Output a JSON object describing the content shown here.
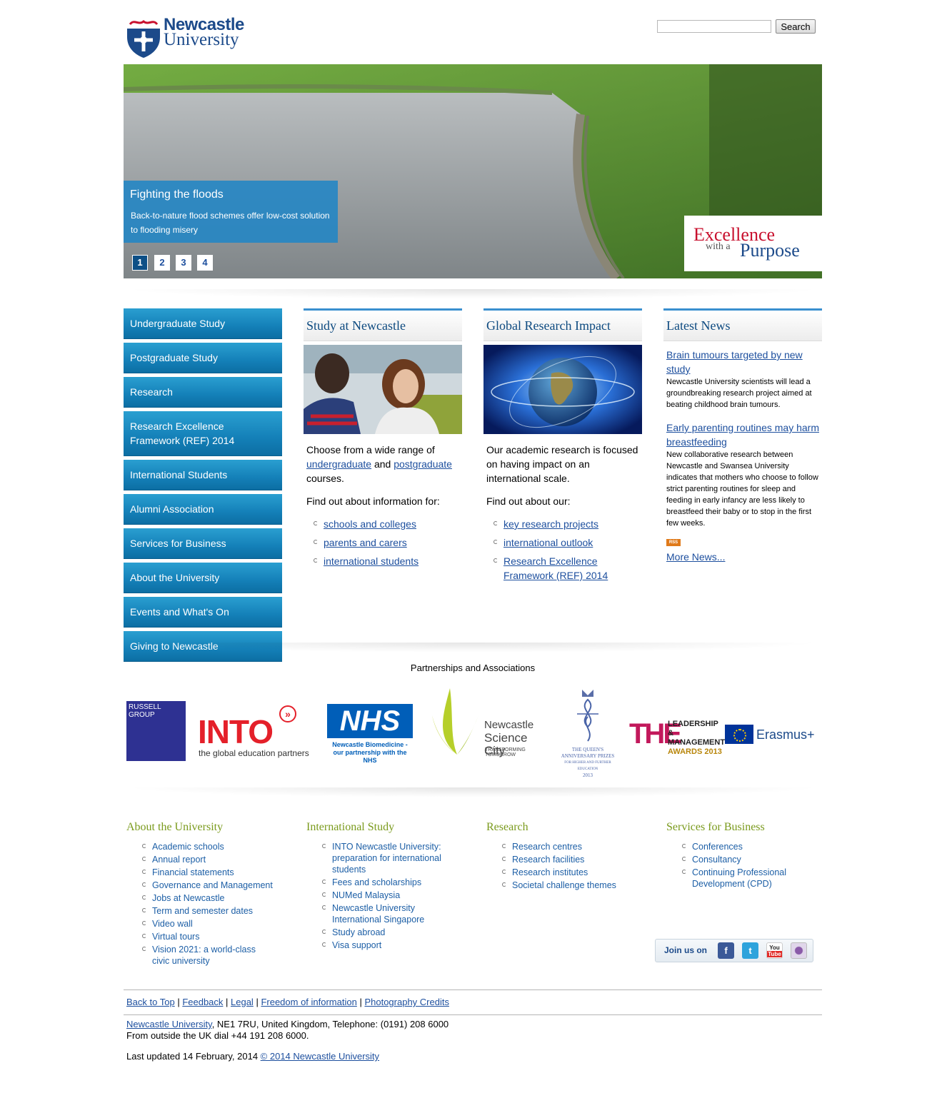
{
  "header": {
    "logo_line1": "Newcastle",
    "logo_line2": "University",
    "search_placeholder": "",
    "search_button": "Search"
  },
  "hero": {
    "title": "Fighting the floods",
    "description": "Back-to-nature flood schemes offer low-cost solution to flooding misery",
    "slides": [
      "1",
      "2",
      "3",
      "4"
    ],
    "active_slide": "1",
    "badge_line1": "Excellence",
    "badge_with": "with a",
    "badge_line2": "Purpose"
  },
  "leftnav": [
    "Undergraduate Study",
    "Postgraduate Study",
    "Research",
    "Research Excellence Framework (REF) 2014",
    "International Students",
    "Alumni Association",
    "Services for Business",
    "About the University",
    "Events and What's On",
    "Giving to Newcastle"
  ],
  "study": {
    "heading": "Study at Newcastle",
    "intro_pre": "Choose from a wide range of ",
    "intro_link1": "undergraduate",
    "intro_mid": " and ",
    "intro_link2": "postgraduate",
    "intro_post": " courses.",
    "find_out": "Find out about information for:",
    "links": [
      "schools and colleges",
      "parents and carers",
      "international students"
    ]
  },
  "research": {
    "heading": "Global Research Impact",
    "intro": "Our academic research is focused on having impact on an international scale.",
    "find_out": "Find out about our:",
    "links": [
      "key research projects",
      "international outlook",
      "Research Excellence Framework (REF) 2014"
    ]
  },
  "news": {
    "heading": "Latest News",
    "items": [
      {
        "title": "Brain tumours targeted by new study",
        "desc": "Newcastle University scientists will lead a groundbreaking research project aimed at beating childhood brain tumours."
      },
      {
        "title": "Early parenting routines may harm breastfeeding",
        "desc": "New collaborative research between Newcastle and Swansea University indicates that mothers who choose to follow strict parenting routines for sleep and feeding in early infancy are less likely to breastfeed their baby or to stop in the first few weeks."
      }
    ],
    "rss": "RSS",
    "more": "More News..."
  },
  "partners": {
    "title": "Partnerships and Associations",
    "russell": "RUSSELL GROUP",
    "into": "INTO",
    "into_sub": "the global education partners",
    "nhs": "NHS",
    "nhs_sub": "Newcastle Biomedicine - our partnership with the NHS",
    "sci1": "Newcastle",
    "sci2": "Science City",
    "sci3": "TRANSFORMING TOMORROW",
    "queens1": "THE QUEEN'S",
    "queens2": "ANNIVERSARY PRIZES",
    "queens3": "FOR HIGHER AND FURTHER EDUCATION",
    "queens4": "2013",
    "the": "THE",
    "the_sub1": "LEADERSHIP &",
    "the_sub2": "MANAGEMENT",
    "the_sub3": "AWARDS 2013",
    "erasmus": "Erasmus+"
  },
  "footer_cols": [
    {
      "heading": "About the University",
      "links": [
        "Academic schools",
        "Annual report",
        "Financial statements",
        "Governance and Management",
        "Jobs at Newcastle",
        "Term and semester dates",
        "Video wall",
        "Virtual tours",
        "Vision 2021: a world-class civic university"
      ]
    },
    {
      "heading": "International Study",
      "links": [
        "INTO Newcastle University: preparation for international students",
        "Fees and scholarships",
        "NUMed Malaysia",
        "Newcastle University International Singapore",
        "Study abroad",
        "Visa support"
      ]
    },
    {
      "heading": "Research",
      "links": [
        "Research centres",
        "Research facilities",
        "Research institutes",
        "Societal challenge themes"
      ]
    },
    {
      "heading": "Services for Business",
      "links": [
        "Conferences",
        "Consultancy",
        "Continuing Professional Development (CPD)"
      ]
    }
  ],
  "joinus": {
    "label": "Join us on",
    "facebook": "f",
    "twitter": "t",
    "youtube1": "You",
    "youtube2": "Tube",
    "itunes": ""
  },
  "bottom": {
    "links": [
      "Back to Top",
      "Feedback",
      "Legal",
      "Freedom of information",
      "Photography Credits"
    ],
    "sep": " | ",
    "addr_link": "Newcastle University",
    "addr_rest": ", NE1 7RU, United Kingdom, Telephone: (0191) 208 6000",
    "addr_line2": "From outside the UK dial +44 191 208 6000.",
    "updated": "Last updated 14 February, 2014 ",
    "copyright": "© 2014 Newcastle University"
  },
  "colors": {
    "accent": "#1480b8",
    "footer_heading": "#7a9a1c",
    "link": "#1d4f9e"
  }
}
